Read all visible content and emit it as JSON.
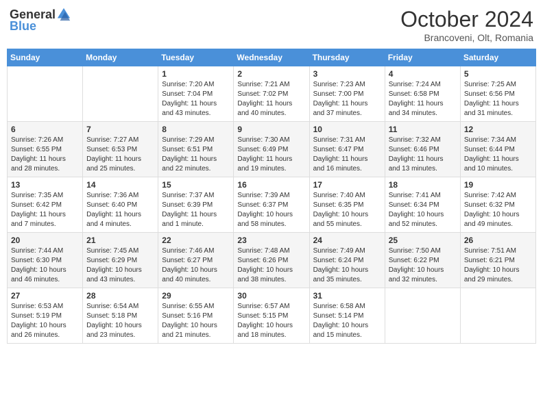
{
  "header": {
    "logo_general": "General",
    "logo_blue": "Blue",
    "month": "October 2024",
    "location": "Brancoveni, Olt, Romania"
  },
  "days_of_week": [
    "Sunday",
    "Monday",
    "Tuesday",
    "Wednesday",
    "Thursday",
    "Friday",
    "Saturday"
  ],
  "weeks": [
    [
      {
        "day": "",
        "data": ""
      },
      {
        "day": "",
        "data": ""
      },
      {
        "day": "1",
        "data": "Sunrise: 7:20 AM\nSunset: 7:04 PM\nDaylight: 11 hours and 43 minutes."
      },
      {
        "day": "2",
        "data": "Sunrise: 7:21 AM\nSunset: 7:02 PM\nDaylight: 11 hours and 40 minutes."
      },
      {
        "day": "3",
        "data": "Sunrise: 7:23 AM\nSunset: 7:00 PM\nDaylight: 11 hours and 37 minutes."
      },
      {
        "day": "4",
        "data": "Sunrise: 7:24 AM\nSunset: 6:58 PM\nDaylight: 11 hours and 34 minutes."
      },
      {
        "day": "5",
        "data": "Sunrise: 7:25 AM\nSunset: 6:56 PM\nDaylight: 11 hours and 31 minutes."
      }
    ],
    [
      {
        "day": "6",
        "data": "Sunrise: 7:26 AM\nSunset: 6:55 PM\nDaylight: 11 hours and 28 minutes."
      },
      {
        "day": "7",
        "data": "Sunrise: 7:27 AM\nSunset: 6:53 PM\nDaylight: 11 hours and 25 minutes."
      },
      {
        "day": "8",
        "data": "Sunrise: 7:29 AM\nSunset: 6:51 PM\nDaylight: 11 hours and 22 minutes."
      },
      {
        "day": "9",
        "data": "Sunrise: 7:30 AM\nSunset: 6:49 PM\nDaylight: 11 hours and 19 minutes."
      },
      {
        "day": "10",
        "data": "Sunrise: 7:31 AM\nSunset: 6:47 PM\nDaylight: 11 hours and 16 minutes."
      },
      {
        "day": "11",
        "data": "Sunrise: 7:32 AM\nSunset: 6:46 PM\nDaylight: 11 hours and 13 minutes."
      },
      {
        "day": "12",
        "data": "Sunrise: 7:34 AM\nSunset: 6:44 PM\nDaylight: 11 hours and 10 minutes."
      }
    ],
    [
      {
        "day": "13",
        "data": "Sunrise: 7:35 AM\nSunset: 6:42 PM\nDaylight: 11 hours and 7 minutes."
      },
      {
        "day": "14",
        "data": "Sunrise: 7:36 AM\nSunset: 6:40 PM\nDaylight: 11 hours and 4 minutes."
      },
      {
        "day": "15",
        "data": "Sunrise: 7:37 AM\nSunset: 6:39 PM\nDaylight: 11 hours and 1 minute."
      },
      {
        "day": "16",
        "data": "Sunrise: 7:39 AM\nSunset: 6:37 PM\nDaylight: 10 hours and 58 minutes."
      },
      {
        "day": "17",
        "data": "Sunrise: 7:40 AM\nSunset: 6:35 PM\nDaylight: 10 hours and 55 minutes."
      },
      {
        "day": "18",
        "data": "Sunrise: 7:41 AM\nSunset: 6:34 PM\nDaylight: 10 hours and 52 minutes."
      },
      {
        "day": "19",
        "data": "Sunrise: 7:42 AM\nSunset: 6:32 PM\nDaylight: 10 hours and 49 minutes."
      }
    ],
    [
      {
        "day": "20",
        "data": "Sunrise: 7:44 AM\nSunset: 6:30 PM\nDaylight: 10 hours and 46 minutes."
      },
      {
        "day": "21",
        "data": "Sunrise: 7:45 AM\nSunset: 6:29 PM\nDaylight: 10 hours and 43 minutes."
      },
      {
        "day": "22",
        "data": "Sunrise: 7:46 AM\nSunset: 6:27 PM\nDaylight: 10 hours and 40 minutes."
      },
      {
        "day": "23",
        "data": "Sunrise: 7:48 AM\nSunset: 6:26 PM\nDaylight: 10 hours and 38 minutes."
      },
      {
        "day": "24",
        "data": "Sunrise: 7:49 AM\nSunset: 6:24 PM\nDaylight: 10 hours and 35 minutes."
      },
      {
        "day": "25",
        "data": "Sunrise: 7:50 AM\nSunset: 6:22 PM\nDaylight: 10 hours and 32 minutes."
      },
      {
        "day": "26",
        "data": "Sunrise: 7:51 AM\nSunset: 6:21 PM\nDaylight: 10 hours and 29 minutes."
      }
    ],
    [
      {
        "day": "27",
        "data": "Sunrise: 6:53 AM\nSunset: 5:19 PM\nDaylight: 10 hours and 26 minutes."
      },
      {
        "day": "28",
        "data": "Sunrise: 6:54 AM\nSunset: 5:18 PM\nDaylight: 10 hours and 23 minutes."
      },
      {
        "day": "29",
        "data": "Sunrise: 6:55 AM\nSunset: 5:16 PM\nDaylight: 10 hours and 21 minutes."
      },
      {
        "day": "30",
        "data": "Sunrise: 6:57 AM\nSunset: 5:15 PM\nDaylight: 10 hours and 18 minutes."
      },
      {
        "day": "31",
        "data": "Sunrise: 6:58 AM\nSunset: 5:14 PM\nDaylight: 10 hours and 15 minutes."
      },
      {
        "day": "",
        "data": ""
      },
      {
        "day": "",
        "data": ""
      }
    ]
  ]
}
